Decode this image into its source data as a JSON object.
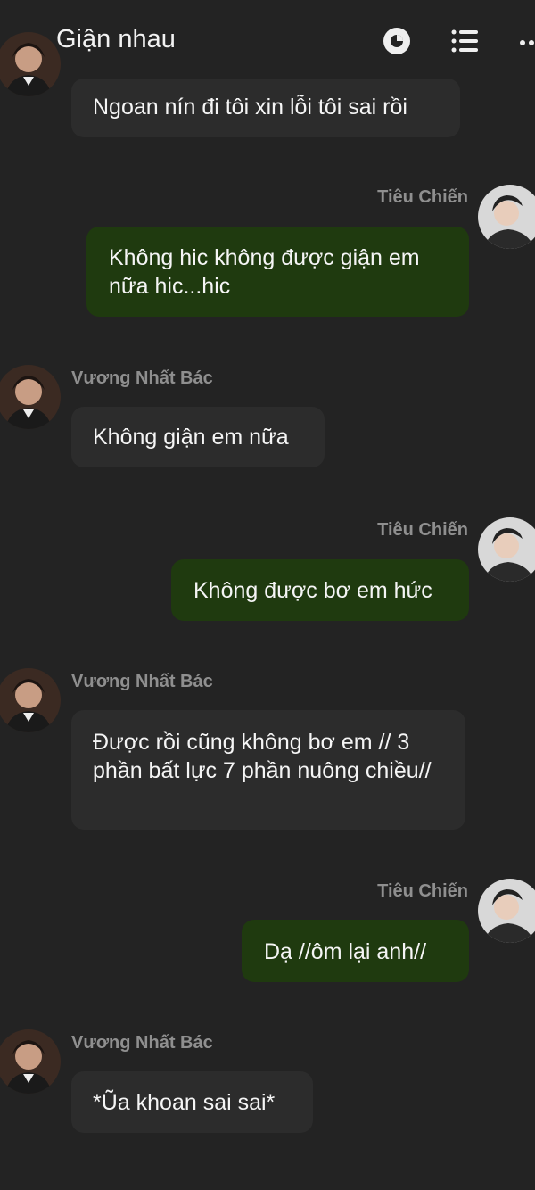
{
  "header": {
    "title": "Giận nhau",
    "icons": [
      "back-icon",
      "timer-icon",
      "list-icon",
      "more-icon"
    ]
  },
  "participants": {
    "left": "Vương Nhất Bác",
    "right": "Tiêu Chiến"
  },
  "messages": [
    {
      "side": "left",
      "sender": "",
      "text": "Ngoan nín đi tôi xin lỗi tôi sai rồi"
    },
    {
      "side": "right",
      "sender": "Tiêu Chiến",
      "text": "Không hic không được giận em nữa hic...hic"
    },
    {
      "side": "left",
      "sender": "Vương Nhất Bác",
      "text": "Không giận em nữa"
    },
    {
      "side": "right",
      "sender": "Tiêu Chiến",
      "text": "Không được bơ em hức"
    },
    {
      "side": "left",
      "sender": "Vương Nhất Bác",
      "text": "Được rồi cũng không bơ em // 3 phần bất lực 7 phần nuông chiều//"
    },
    {
      "side": "right",
      "sender": "Tiêu Chiến",
      "text": "Dạ //ôm lại anh//"
    },
    {
      "side": "left",
      "sender": "Vương Nhất Bác",
      "text": "*Ũa khoan sai sai*"
    }
  ],
  "colors": {
    "background": "#232323",
    "left_bubble": "#2c2c2c",
    "right_bubble": "#1f3a0f",
    "name_text": "#8f8f8f"
  }
}
